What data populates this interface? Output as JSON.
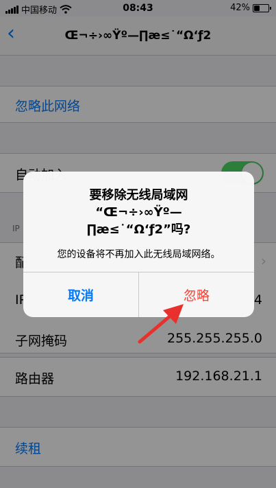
{
  "status_bar": {
    "carrier": "中国移动",
    "time": "08:43",
    "battery": "42%",
    "battery_level": 0.42
  },
  "nav": {
    "back_icon": "chevron-left-icon",
    "title": "Œ¬÷›∞Ÿº—∏æ≤˙“Ω‘ƒ2"
  },
  "settings": {
    "forget_network": "忽略此网络",
    "auto_join": "自动加入",
    "auto_join_on": true,
    "ip_header": "IP",
    "configure_ip": "配",
    "ip_address_label": "IP",
    "ip_address_value": "4",
    "subnet_label": "子网掩码",
    "subnet_value": "255.255.255.0",
    "router_label": "路由器",
    "router_value": "192.168.21.1",
    "renew_lease": "续租"
  },
  "alert": {
    "title_line1": "要移除无线局域网",
    "title_line2": "“Œ¬÷›∞Ÿº—",
    "title_line3": "∏æ≤˙“Ω‘ƒ2”吗?",
    "message": "您的设备将不再加入此无线局域网络。",
    "cancel_label": "取消",
    "ignore_label": "忽略"
  },
  "colors": {
    "accent": "#007aff",
    "destructive": "#ff3b30",
    "toggle_on": "#4cd964",
    "annotation_arrow": "#e8312d"
  }
}
